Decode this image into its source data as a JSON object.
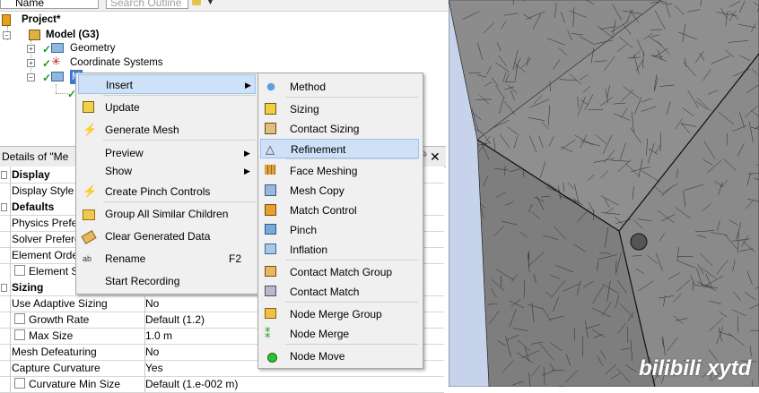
{
  "toolbar": {
    "name_select": "Name",
    "search_placeholder": "Search Outline"
  },
  "tree": {
    "project": "Project*",
    "model": "Model (G3)",
    "geometry": "Geometry",
    "coordinate_systems": "Coordinate Systems",
    "mesh_partial": "M"
  },
  "details": {
    "title": "Details of \"Me",
    "pin": "ᵖ",
    "close": "✕",
    "rows": [
      {
        "label": "Display",
        "value": "",
        "section": true
      },
      {
        "label": "Display Style",
        "value": ""
      },
      {
        "label": "Defaults",
        "value": "",
        "section": true
      },
      {
        "label": "Physics Prefere",
        "value": ""
      },
      {
        "label": "Solver Prefere",
        "value": ""
      },
      {
        "label": "Element Orde",
        "value": ""
      },
      {
        "label": "Element Si",
        "value": "",
        "checkbox": true
      },
      {
        "label": "Sizing",
        "value": "",
        "section": true
      },
      {
        "label": "Use Adaptive Sizing",
        "value": "No"
      },
      {
        "label": "Growth Rate",
        "value": "Default (1.2)",
        "checkbox": true
      },
      {
        "label": "Max Size",
        "value": "1.0 m",
        "checkbox": true
      },
      {
        "label": "Mesh Defeaturing",
        "value": "No"
      },
      {
        "label": "Capture Curvature",
        "value": "Yes"
      },
      {
        "label": "Curvature Min Size",
        "value": "Default (1.e-002 m)",
        "checkbox": true
      }
    ]
  },
  "context_menu": {
    "items": [
      {
        "label": "Insert",
        "icon": "none",
        "submenu": true
      },
      {
        "label": "Update",
        "icon": "update-icon"
      },
      {
        "label": "Generate Mesh",
        "icon": "lightning-icon"
      },
      {
        "label": "Preview",
        "icon": "none",
        "submenu": true
      },
      {
        "label": "Show",
        "icon": "none",
        "submenu": true
      },
      {
        "label": "Create Pinch Controls",
        "icon": "lightning-icon"
      },
      {
        "label": "Group All Similar Children",
        "icon": "folder-icon"
      },
      {
        "label": "Clear Generated Data",
        "icon": "eraser-icon"
      },
      {
        "label": "Rename",
        "icon": "rename-icon",
        "shortcut": "F2"
      },
      {
        "label": "Start Recording",
        "icon": "none"
      }
    ]
  },
  "insert_submenu": {
    "items": [
      {
        "label": "Method",
        "icon": "method-icon"
      },
      {
        "label": "Sizing",
        "icon": "sizing-icon"
      },
      {
        "label": "Contact Sizing",
        "icon": "contact-sizing-icon"
      },
      {
        "label": "Refinement",
        "icon": "refinement-icon"
      },
      {
        "label": "Face Meshing",
        "icon": "face-meshing-icon"
      },
      {
        "label": "Mesh Copy",
        "icon": "mesh-copy-icon"
      },
      {
        "label": "Match Control",
        "icon": "match-control-icon"
      },
      {
        "label": "Pinch",
        "icon": "pinch-icon"
      },
      {
        "label": "Inflation",
        "icon": "inflation-icon"
      },
      {
        "label": "Contact Match Group",
        "icon": "contact-match-group-icon"
      },
      {
        "label": "Contact Match",
        "icon": "contact-match-icon"
      },
      {
        "label": "Node Merge Group",
        "icon": "node-merge-group-icon"
      },
      {
        "label": "Node Merge",
        "icon": "node-merge-icon"
      },
      {
        "label": "Node Move",
        "icon": "node-move-icon"
      }
    ]
  },
  "watermark": "bilibili xytd",
  "colors": {
    "menu_highlight": "#cfe1f7",
    "mesh_gray": "#8c8c8c",
    "viewport_bg": "#c6d3ea",
    "check_green": "#1a9a1a"
  }
}
